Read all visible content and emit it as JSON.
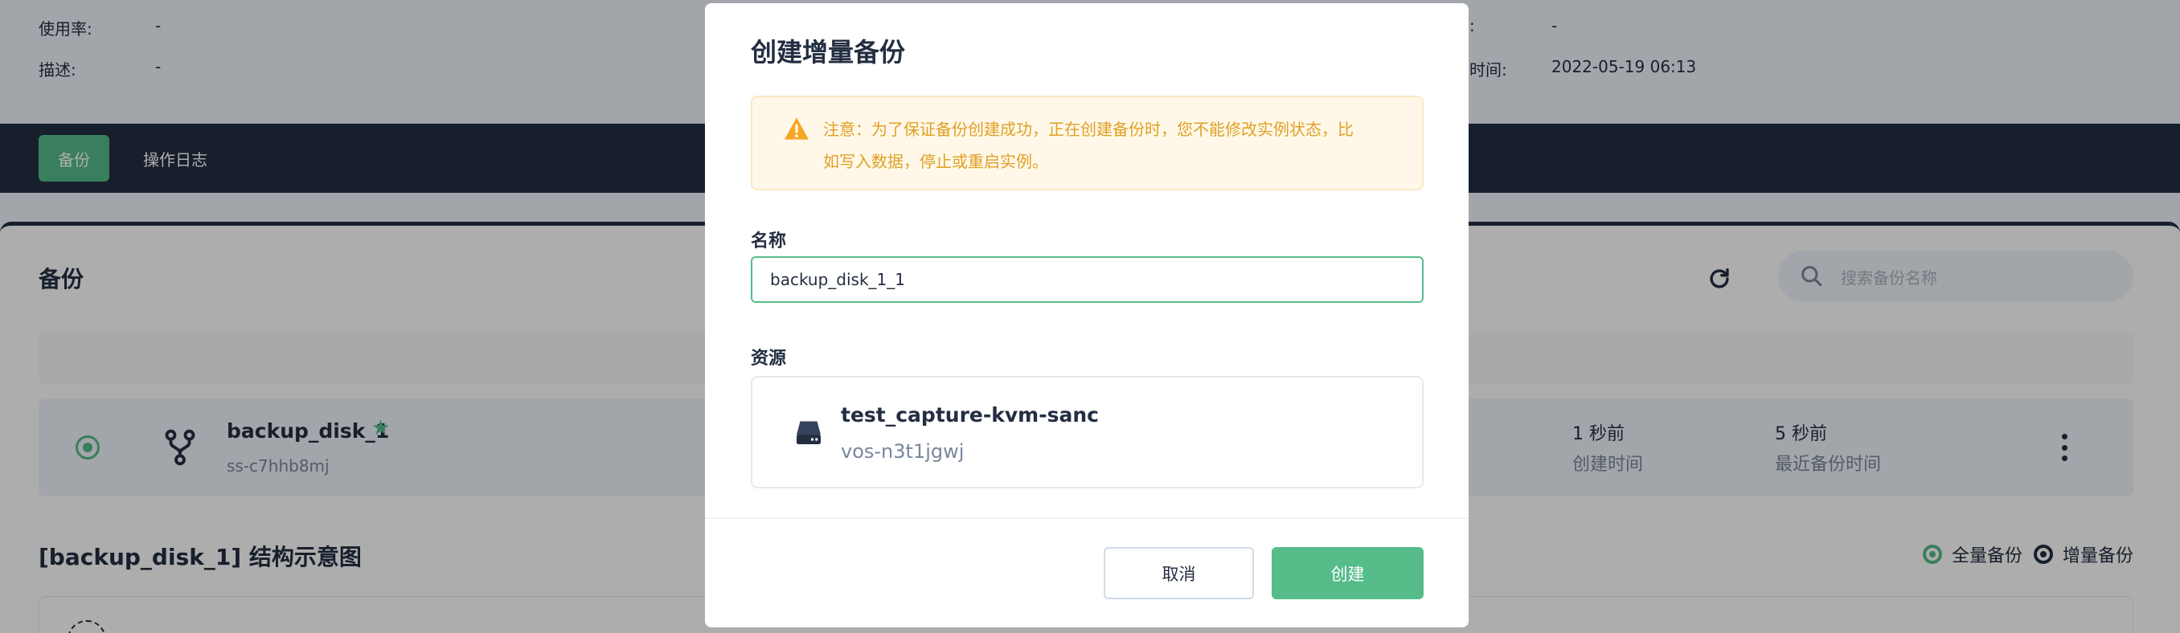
{
  "page": {
    "info": {
      "usage_label": "使用率:",
      "usage_value": "-",
      "desc_label": "描述:",
      "desc_value": "-",
      "right_label_1": ":",
      "right_value_1": "-",
      "right_label_2": "时间:",
      "right_value_2": "2022-05-19 06:13"
    },
    "tabs": [
      {
        "label": "备份",
        "active": true
      },
      {
        "label": "操作日志",
        "active": false
      }
    ],
    "backup_section": {
      "title": "备份",
      "search_placeholder": "搜索备份名称"
    },
    "backup_row": {
      "name": "backup_disk_1",
      "star": "★",
      "id": "ss-c7hhb8mj",
      "created_value": "1 秒前",
      "created_label": "创建时间",
      "last_backup_value": "5 秒前",
      "last_backup_label": "最近备份时间"
    },
    "diagram": {
      "title": "[backup_disk_1] 结构示意图",
      "legend_full": "全量备份",
      "legend_incremental": "增量备份"
    }
  },
  "modal": {
    "title": "创建增量备份",
    "alert_text": "注意：为了保证备份创建成功，正在创建备份时，您不能修改实例状态，比如写入数据，停止或重启实例。",
    "name_label": "名称",
    "name_value": "backup_disk_1_1",
    "resource_label": "资源",
    "resource": {
      "name": "test_capture-kvm-sanc",
      "id": "vos-n3t1jgwj"
    },
    "cancel_label": "取消",
    "create_label": "创建"
  },
  "colors": {
    "accent": "#55bc8a",
    "dark": "#242e42",
    "warning": "#e0a026",
    "overlay": "rgba(0,0,0,0.32)"
  },
  "icons": [
    "warning-icon",
    "refresh-icon",
    "search-icon",
    "fork-icon",
    "star-icon",
    "more-icon",
    "disk-icon"
  ]
}
